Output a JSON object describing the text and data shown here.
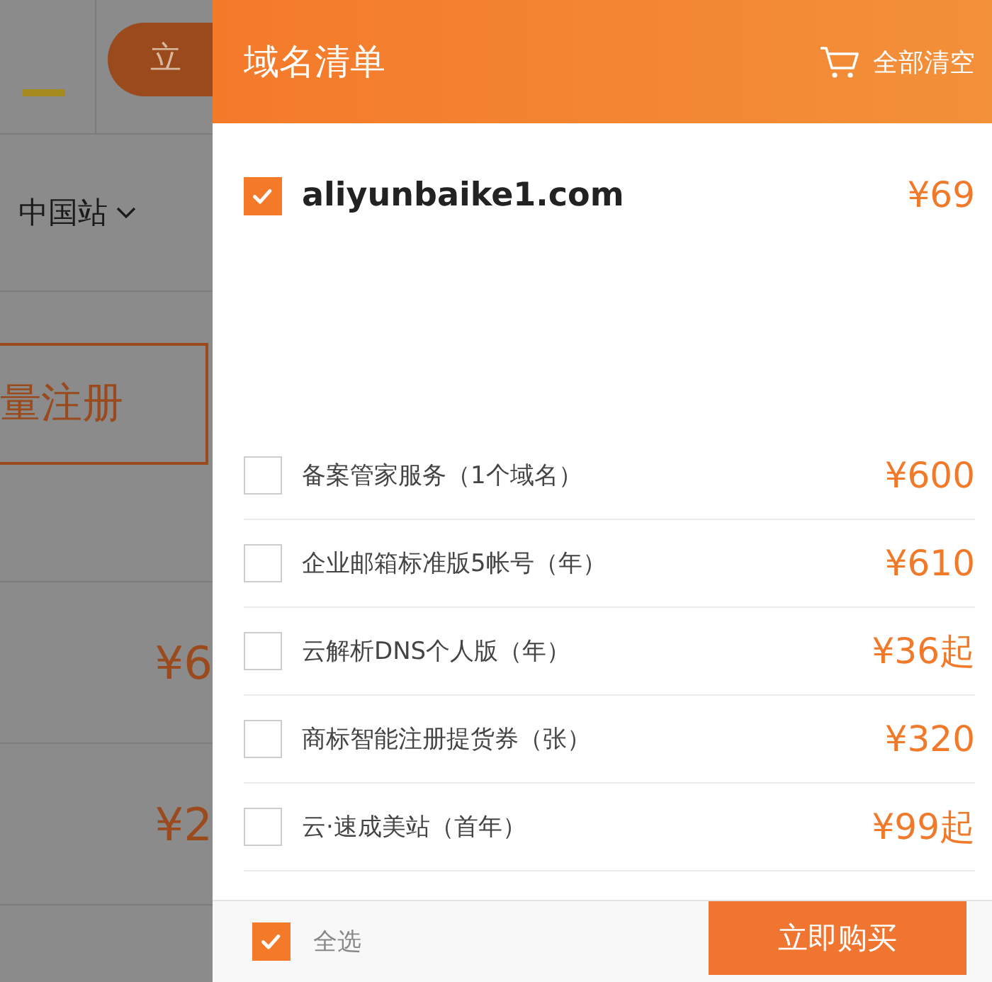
{
  "background_page": {
    "button_label": "立",
    "region": "中国站",
    "batch_button": "量注册",
    "prices": [
      "¥6",
      "¥2"
    ]
  },
  "drawer": {
    "title": "域名清单",
    "clear_all": "全部清空",
    "domain": {
      "name": "aliyunbaike1.com",
      "price": "¥69",
      "checked": true
    },
    "services": [
      {
        "name": "备案管家服务（1个域名）",
        "price": "¥600",
        "checked": false
      },
      {
        "name": "企业邮箱标准版5帐号（年）",
        "price": "¥610",
        "checked": false
      },
      {
        "name": "云解析DNS个人版（年）",
        "price": "¥36起",
        "checked": false
      },
      {
        "name": "商标智能注册提货券（张）",
        "price": "¥320",
        "checked": false
      },
      {
        "name": "云·速成美站（首年）",
        "price": "¥99起",
        "checked": false
      }
    ],
    "select_all": {
      "label": "全选",
      "checked": true
    },
    "buy_button": "立即购买"
  }
}
